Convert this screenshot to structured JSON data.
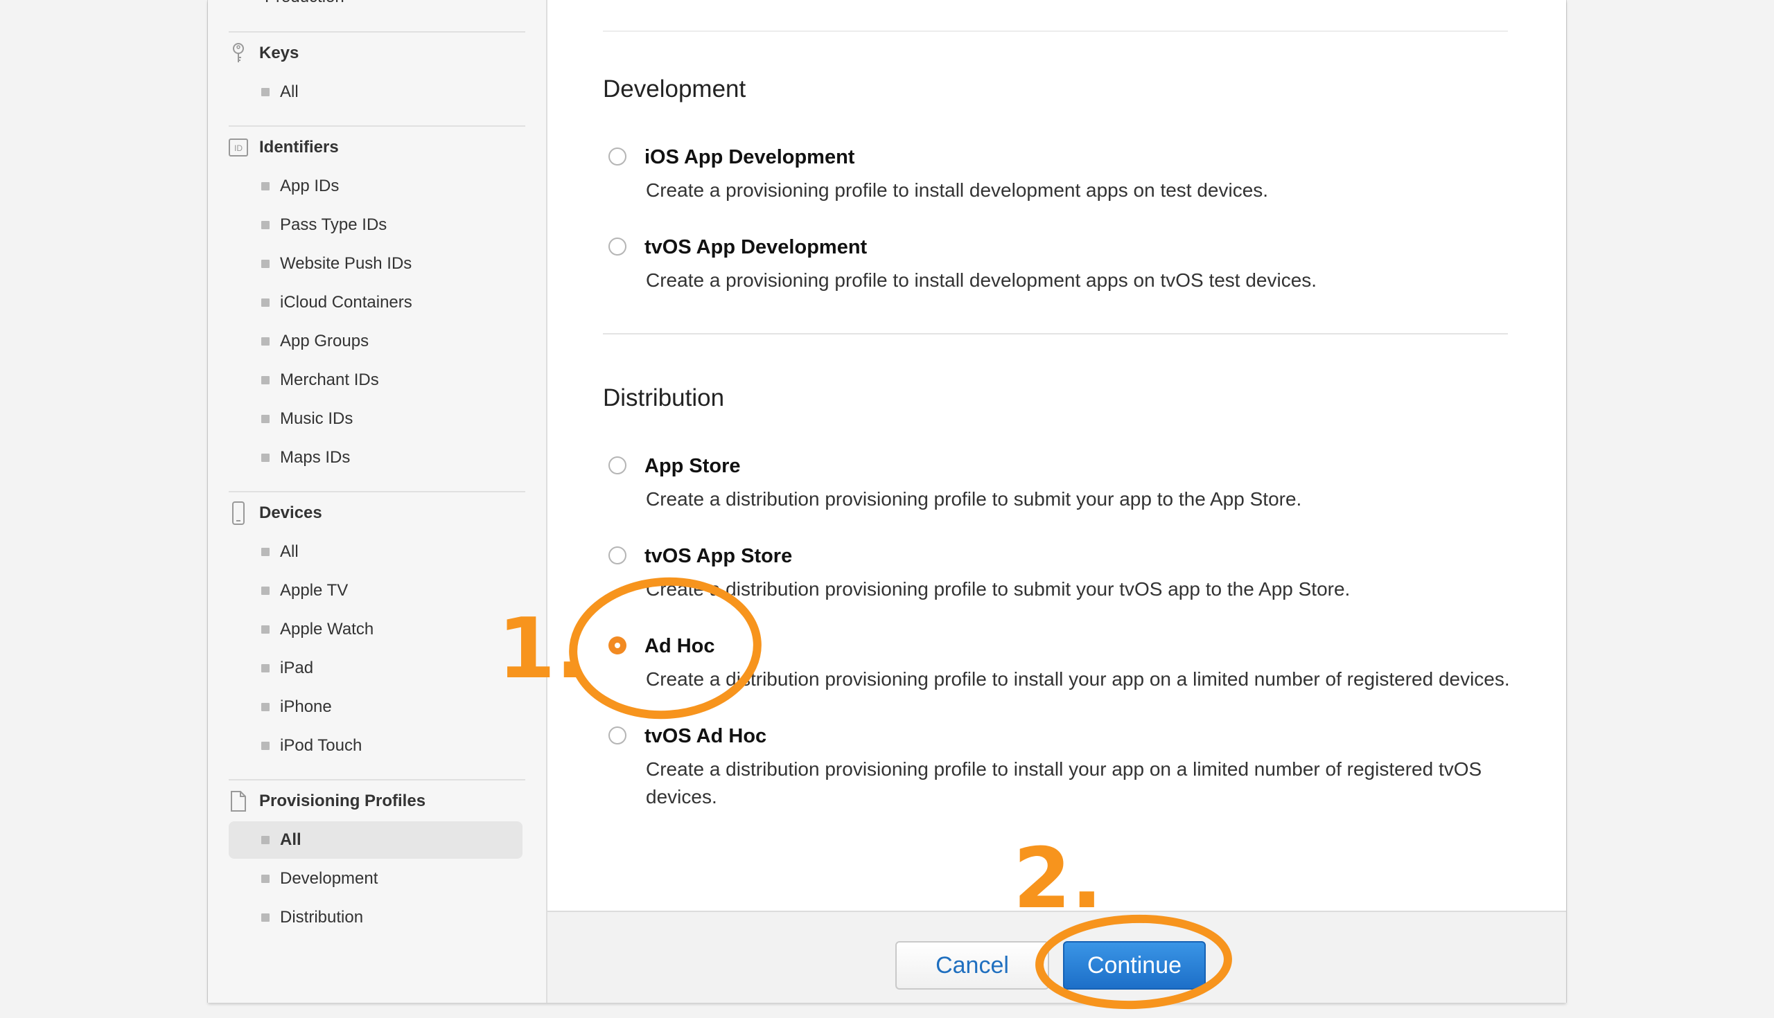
{
  "sidebar": {
    "cut_item": "Production",
    "sections": [
      {
        "icon": "key-icon",
        "title": "Keys",
        "items": [
          "All"
        ]
      },
      {
        "icon": "id-badge-icon",
        "title": "Identifiers",
        "items": [
          "App IDs",
          "Pass Type IDs",
          "Website Push IDs",
          "iCloud Containers",
          "App Groups",
          "Merchant IDs",
          "Music IDs",
          "Maps IDs"
        ]
      },
      {
        "icon": "device-icon",
        "title": "Devices",
        "items": [
          "All",
          "Apple TV",
          "Apple Watch",
          "iPad",
          "iPhone",
          "iPod Touch"
        ]
      },
      {
        "icon": "document-icon",
        "title": "Provisioning Profiles",
        "items": [
          "All",
          "Development",
          "Distribution"
        ],
        "active_index": 0
      }
    ]
  },
  "main": {
    "development": {
      "title": "Development",
      "options": [
        {
          "title": "iOS App Development",
          "desc": "Create a provisioning profile to install development apps on test devices.",
          "selected": false
        },
        {
          "title": "tvOS App Development",
          "desc": "Create a provisioning profile to install development apps on tvOS test devices.",
          "selected": false
        }
      ]
    },
    "distribution": {
      "title": "Distribution",
      "options": [
        {
          "title": "App Store",
          "desc": "Create a distribution provisioning profile to submit your app to the App Store.",
          "selected": false
        },
        {
          "title": "tvOS App Store",
          "desc": "Create a distribution provisioning profile to submit your tvOS app to the App Store.",
          "selected": false
        },
        {
          "title": "Ad Hoc",
          "desc": "Create a distribution provisioning profile to install your app on a limited number of registered devices.",
          "selected": true
        },
        {
          "title": "tvOS Ad Hoc",
          "desc": "Create a distribution provisioning profile to install your app on a limited number of registered tvOS devices.",
          "selected": false
        }
      ]
    }
  },
  "footer": {
    "cancel_label": "Cancel",
    "continue_label": "Continue"
  },
  "annotations": {
    "step1": "1.",
    "step2": "2.",
    "color": "#f7941d"
  },
  "colors": {
    "accent_blue": "#1f6fbf",
    "radio_selected": "#f28a22"
  }
}
